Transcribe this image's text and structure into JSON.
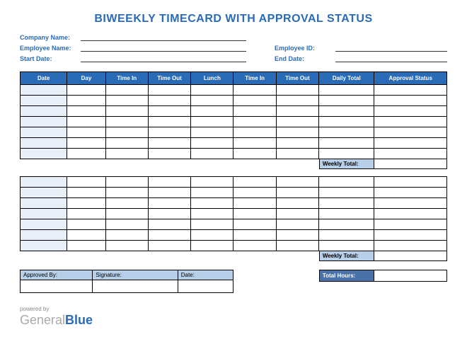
{
  "title": "BIWEEKLY TIMECARD WITH APPROVAL STATUS",
  "meta": {
    "company_label": "Company Name:",
    "employee_name_label": "Employee Name:",
    "start_date_label": "Start Date:",
    "employee_id_label": "Employee ID:",
    "end_date_label": "End Date:"
  },
  "columns": {
    "date": "Date",
    "day": "Day",
    "time_in_1": "Time In",
    "time_out_1": "Time Out",
    "lunch": "Lunch",
    "time_in_2": "Time In",
    "time_out_2": "Time Out",
    "daily_total": "Daily Total",
    "approval_status": "Approval Status"
  },
  "weekly_total_label": "Weekly Total:",
  "approval": {
    "approved_by": "Approved By:",
    "signature": "Signature:",
    "date": "Date:"
  },
  "total_hours_label": "Total Hours:",
  "footer": {
    "powered_by": "powered by",
    "brand_general": "General",
    "brand_blue": "Blue"
  }
}
